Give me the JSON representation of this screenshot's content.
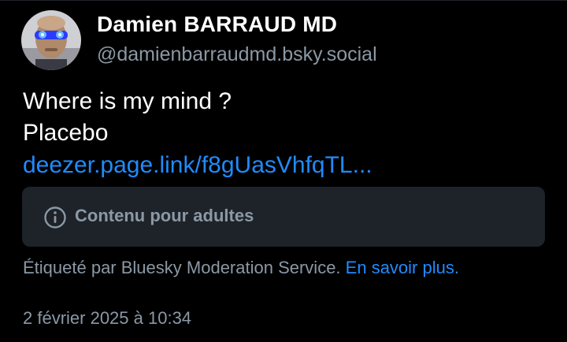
{
  "author": {
    "display_name": "Damien BARRAUD MD",
    "handle": "@damienbarraudmd.bsky.social",
    "avatar_icon": "avatar-photo"
  },
  "post": {
    "lines": [
      "Where is my mind ?",
      "Placebo"
    ],
    "link_text": "deezer.page.link/f8gUasVhfqTL..."
  },
  "content_warning": {
    "icon": "info-circle-icon",
    "label": "Contenu pour adultes"
  },
  "moderation": {
    "text": "Étiqueté par Bluesky Moderation Service.",
    "link": "En savoir plus."
  },
  "timestamp": "2 février 2025 à 10:34",
  "colors": {
    "background": "#000000",
    "text": "#ffffff",
    "muted": "#8b98a5",
    "link": "#208bfe",
    "warning_bg": "#1e2329"
  }
}
